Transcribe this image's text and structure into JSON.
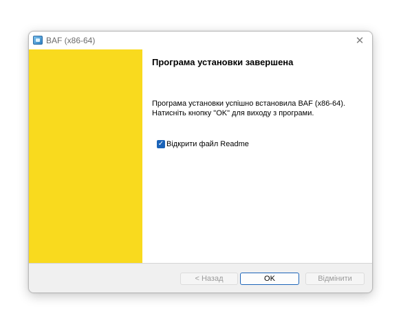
{
  "window": {
    "title": "BAF (x86-64)",
    "app_icon": "installer-app-icon",
    "close_glyph": "✕"
  },
  "banner": {
    "color": "#f9da1e"
  },
  "content": {
    "heading": "Програма установки завершена",
    "message_line1": "Програма установки успішно встановила BAF (x86-64).",
    "message_line2": "Натисніть кнопку \"OK\" для виходу з програми."
  },
  "options": {
    "open_readme": {
      "label": "Відкрити файл Readme",
      "checked": true,
      "check_glyph": "✓"
    }
  },
  "buttons": {
    "back": {
      "label": "< Назад",
      "enabled": false
    },
    "ok": {
      "label": "OK",
      "enabled": true,
      "default": true
    },
    "cancel": {
      "label": "Відмінити",
      "enabled": false
    }
  },
  "colors": {
    "accent": "#1a63b8",
    "footer_bg": "#f0f0f0"
  }
}
